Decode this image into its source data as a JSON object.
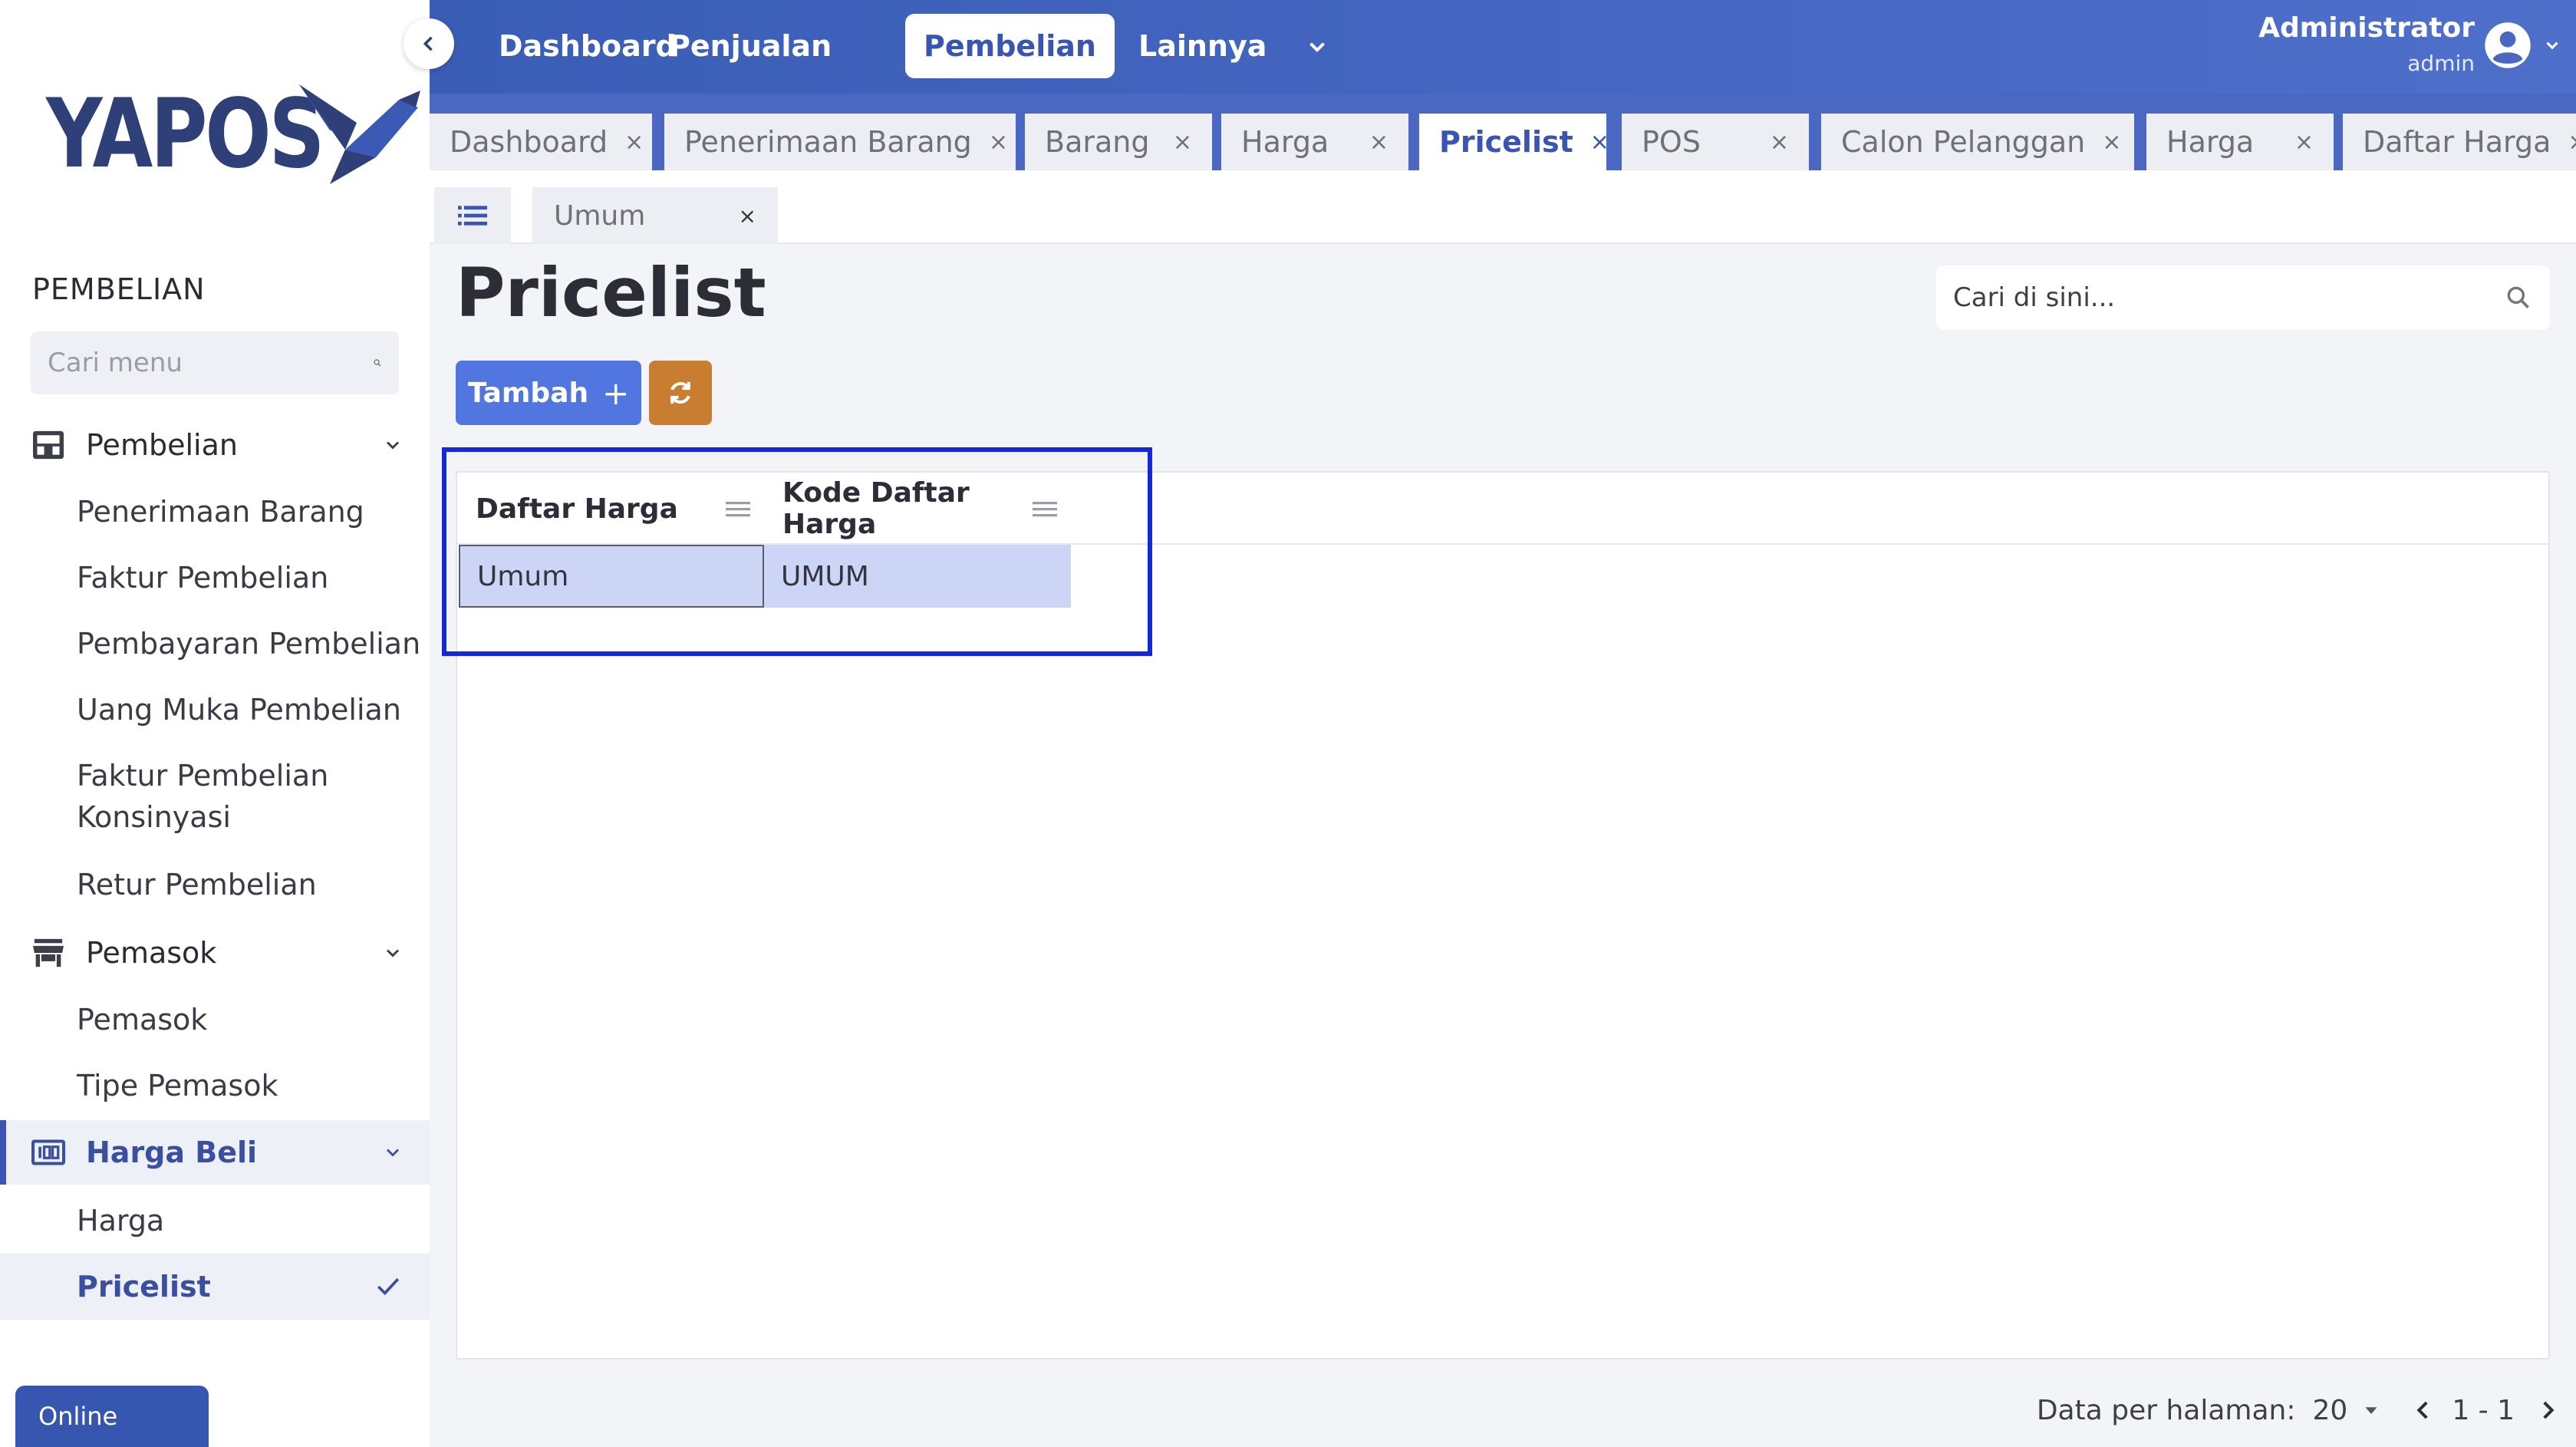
{
  "brand": {
    "logo_text": "YAPOS"
  },
  "topnav": {
    "items": [
      "Dashboard",
      "Penjualan",
      "Pembelian",
      "Lainnya"
    ],
    "active": "Pembelian",
    "user_name": "Administrator",
    "user_role": "admin"
  },
  "tabs": [
    {
      "label": "Dashboard"
    },
    {
      "label": "Penerimaan Barang"
    },
    {
      "label": "Barang"
    },
    {
      "label": "Harga"
    },
    {
      "label": "Pricelist",
      "active": true
    },
    {
      "label": "POS"
    },
    {
      "label": "Calon Pelanggan"
    },
    {
      "label": "Harga"
    },
    {
      "label": "Daftar Harga"
    }
  ],
  "tab_close": "×",
  "subtab": {
    "label": "Umum",
    "close": "×"
  },
  "sidebar": {
    "section_title": "PEMBELIAN",
    "search_placeholder": "Cari menu",
    "groups": [
      {
        "label": "Pembelian",
        "icon": "inbox-tray-icon",
        "items": [
          "Penerimaan Barang",
          "Faktur Pembelian",
          "Pembayaran Pembelian",
          "Uang Muka Pembelian",
          "Faktur Pembelian Konsinyasi",
          "Retur Pembelian"
        ]
      },
      {
        "label": "Pemasok",
        "icon": "store-icon",
        "items": [
          "Pemasok",
          "Tipe Pemasok"
        ]
      },
      {
        "label": "Harga Beli",
        "icon": "price-tag-icon",
        "active": true,
        "items": [
          "Harga",
          "Pricelist"
        ],
        "selected": "Pricelist"
      }
    ],
    "status": "Online"
  },
  "page": {
    "title": "Pricelist",
    "search_placeholder": "Cari di sini...",
    "add_button": "Tambah",
    "add_icon": "+"
  },
  "table": {
    "columns": [
      "Daftar Harga",
      "Kode Daftar Harga"
    ],
    "rows": [
      [
        "Umum",
        "UMUM"
      ]
    ]
  },
  "pagination": {
    "per_page_label": "Data per halaman:",
    "per_page": "20",
    "range": "1 - 1"
  },
  "colors": {
    "primary": "#3a5db6",
    "accent_button": "#5276e0",
    "refresh_button": "#c97d30",
    "selection_row": "#cdd5f7",
    "highlight_box": "#1428d8"
  }
}
